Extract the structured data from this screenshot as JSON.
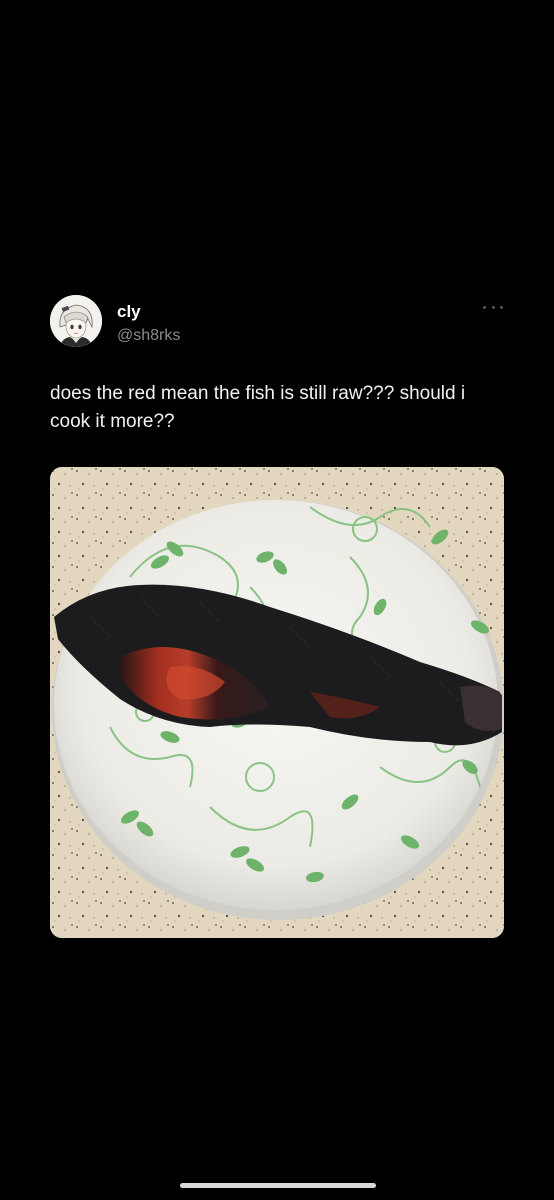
{
  "post": {
    "author": {
      "display_name": "cly",
      "handle": "@sh8rks",
      "avatar_icon": "anime-avatar"
    },
    "menu_icon": "more-options-icon",
    "text": "does the red mean the fish is still raw??? should i cook it more??",
    "media": {
      "alt": "burnt fish on a white plate with green leaf pattern"
    }
  },
  "colors": {
    "background": "#000000",
    "text": "#f2f2f2",
    "handle": "#8b8b8b"
  }
}
